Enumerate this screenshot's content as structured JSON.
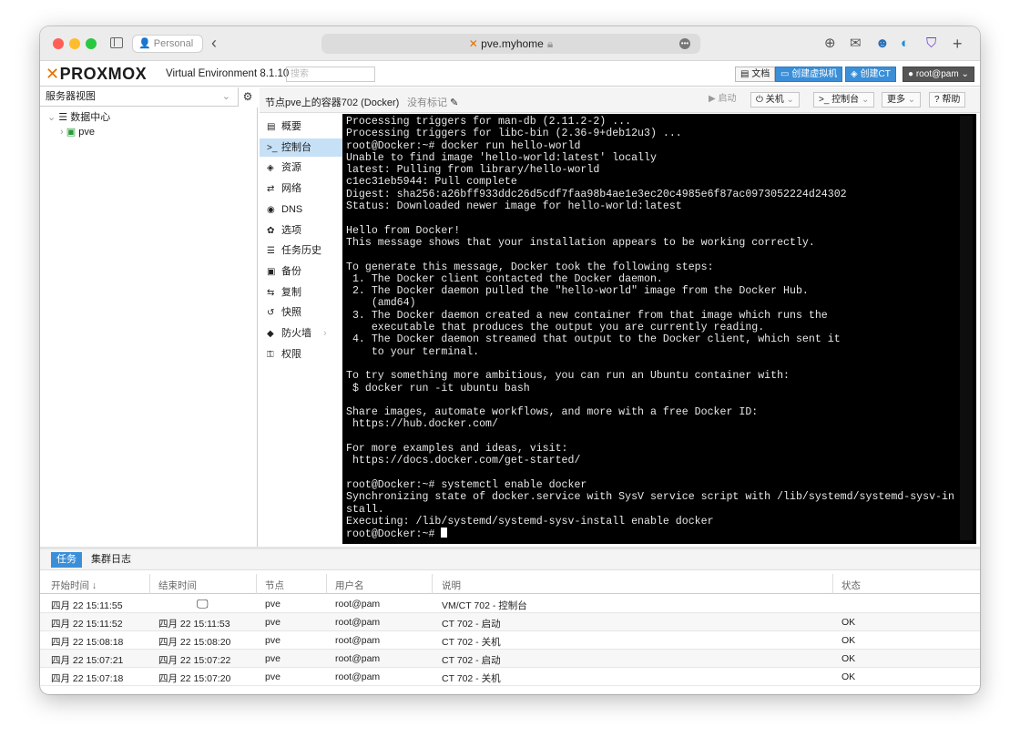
{
  "browser": {
    "profile": "Personal",
    "url": "pve.myhome",
    "lights": {
      "close": "#fe5f57",
      "minimize": "#febc2e",
      "maximize": "#28c840"
    }
  },
  "pve": {
    "logo": "PROXMOX",
    "product": "Virtual Environment 8.1.10",
    "search_placeholder": "搜索",
    "buttons": {
      "docs": "文档",
      "create_vm": "创建虚拟机",
      "create_ct": "创建CT",
      "user": "root@pam"
    }
  },
  "tree": {
    "view": "服务器视图",
    "datacenter": "数据中心",
    "node": "pve"
  },
  "content": {
    "title": "节点pve上的容器702 (Docker)",
    "tags": "没有标记",
    "buttons": {
      "start": "启动",
      "shutdown": "关机",
      "console": "控制台",
      "more": "更多",
      "help": "帮助"
    },
    "menu": [
      {
        "icon": "book-icon",
        "glyph": "▤",
        "label": "概要"
      },
      {
        "icon": "terminal-icon",
        "glyph": ">_",
        "label": "控制台",
        "active": true
      },
      {
        "icon": "cube-icon",
        "glyph": "◈",
        "label": "资源"
      },
      {
        "icon": "exchange-icon",
        "glyph": "⇄",
        "label": "网络"
      },
      {
        "icon": "globe-icon",
        "glyph": "◉",
        "label": "DNS"
      },
      {
        "icon": "gear-icon",
        "glyph": "✿",
        "label": "选项"
      },
      {
        "icon": "list-icon",
        "glyph": "☰",
        "label": "任务历史"
      },
      {
        "icon": "floppy-icon",
        "glyph": "▣",
        "label": "备份"
      },
      {
        "icon": "retweet-icon",
        "glyph": "⇆",
        "label": "复制"
      },
      {
        "icon": "history-icon",
        "glyph": "↺",
        "label": "快照"
      },
      {
        "icon": "shield-icon",
        "glyph": "◆",
        "label": "防火墙"
      },
      {
        "icon": "unlock-icon",
        "glyph": "⚿",
        "label": "权限"
      }
    ]
  },
  "console": {
    "lines": [
      "Processing triggers for man-db (2.11.2-2) ...",
      "Processing triggers for libc-bin (2.36-9+deb12u3) ...",
      "root@Docker:~# docker run hello-world",
      "Unable to find image 'hello-world:latest' locally",
      "latest: Pulling from library/hello-world",
      "c1ec31eb5944: Pull complete",
      "Digest: sha256:a26bff933ddc26d5cdf7faa98b4ae1e3ec20c4985e6f87ac0973052224d24302",
      "Status: Downloaded newer image for hello-world:latest",
      "",
      "Hello from Docker!",
      "This message shows that your installation appears to be working correctly.",
      "",
      "To generate this message, Docker took the following steps:",
      " 1. The Docker client contacted the Docker daemon.",
      " 2. The Docker daemon pulled the \"hello-world\" image from the Docker Hub.",
      "    (amd64)",
      " 3. The Docker daemon created a new container from that image which runs the",
      "    executable that produces the output you are currently reading.",
      " 4. The Docker daemon streamed that output to the Docker client, which sent it",
      "    to your terminal.",
      "",
      "To try something more ambitious, you can run an Ubuntu container with:",
      " $ docker run -it ubuntu bash",
      "",
      "Share images, automate workflows, and more with a free Docker ID:",
      " https://hub.docker.com/",
      "",
      "For more examples and ideas, visit:",
      " https://docs.docker.com/get-started/",
      "",
      "root@Docker:~# systemctl enable docker",
      "Synchronizing state of docker.service with SysV service script with /lib/systemd/systemd-sysv-in",
      "stall.",
      "Executing: /lib/systemd/systemd-sysv-install enable docker",
      "root@Docker:~# "
    ]
  },
  "tasks": {
    "tabs": [
      "任务",
      "集群日志"
    ],
    "columns": [
      "开始时间 ↓",
      "结束时间",
      "节点",
      "用户名",
      "说明",
      "状态"
    ],
    "rows": [
      {
        "start": "四月 22 15:11:55",
        "end": "",
        "node": "pve",
        "user": "root@pam",
        "desc": "VM/CT 702 - 控制台",
        "status": "",
        "running": true
      },
      {
        "start": "四月 22 15:11:52",
        "end": "四月 22 15:11:53",
        "node": "pve",
        "user": "root@pam",
        "desc": "CT 702 - 启动",
        "status": "OK"
      },
      {
        "start": "四月 22 15:08:18",
        "end": "四月 22 15:08:20",
        "node": "pve",
        "user": "root@pam",
        "desc": "CT 702 - 关机",
        "status": "OK"
      },
      {
        "start": "四月 22 15:07:21",
        "end": "四月 22 15:07:22",
        "node": "pve",
        "user": "root@pam",
        "desc": "CT 702 - 启动",
        "status": "OK"
      },
      {
        "start": "四月 22 15:07:18",
        "end": "四月 22 15:07:20",
        "node": "pve",
        "user": "root@pam",
        "desc": "CT 702 - 关机",
        "status": "OK"
      }
    ]
  }
}
